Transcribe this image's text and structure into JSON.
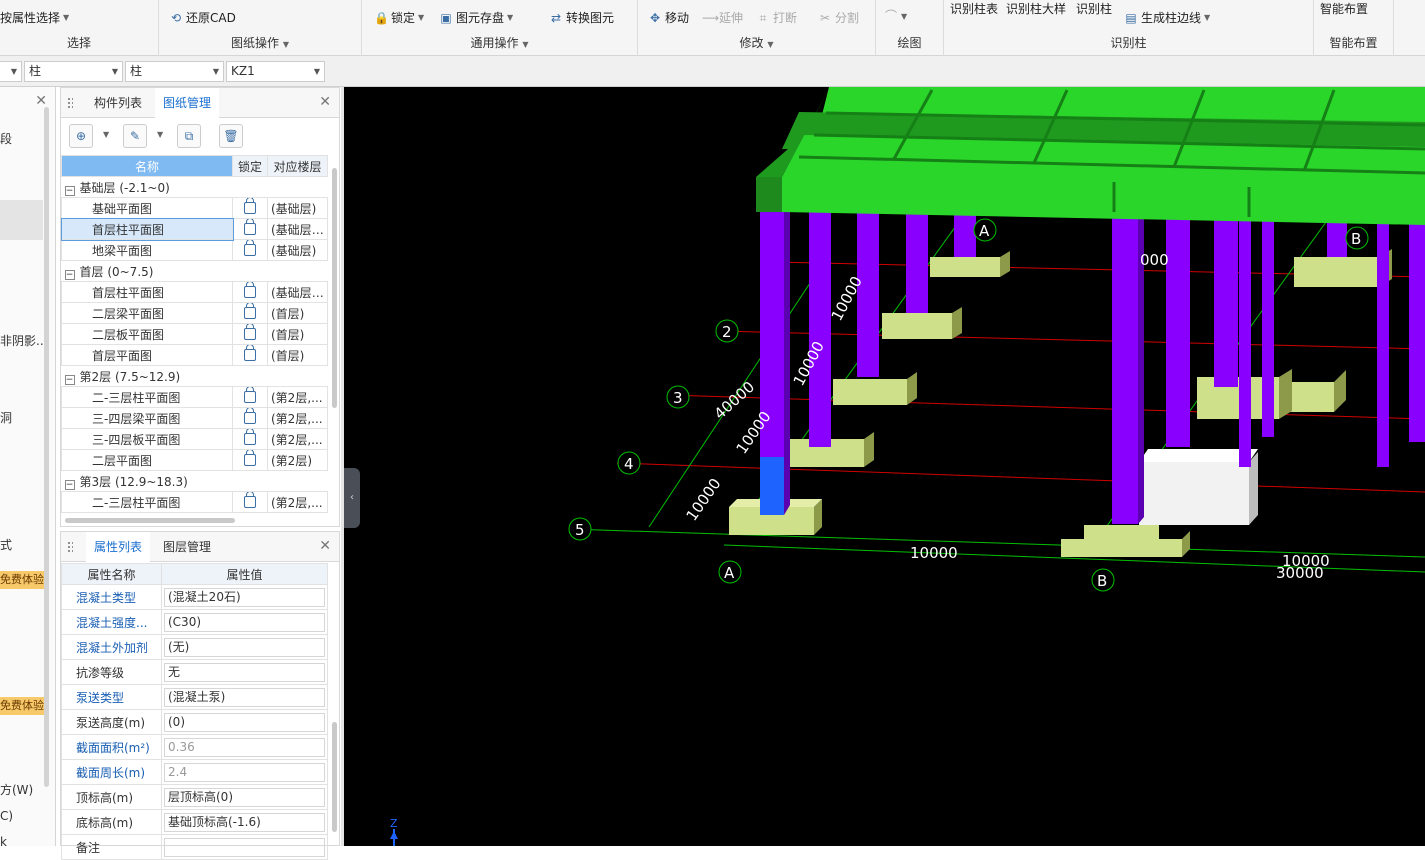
{
  "ribbon": {
    "groups": [
      {
        "label": "选择",
        "buttons": [
          {
            "label": "按属性选择"
          }
        ]
      },
      {
        "label": "图纸操作",
        "buttons": [
          {
            "label": "还原CAD"
          }
        ]
      },
      {
        "label": "通用操作",
        "buttons": [
          {
            "label": "锁定"
          },
          {
            "label": "图元存盘"
          },
          {
            "label": "转换图元"
          }
        ]
      },
      {
        "label": "修改",
        "buttons": [
          {
            "label": "移动"
          },
          {
            "label": "延伸"
          },
          {
            "label": "打断"
          },
          {
            "label": "分割"
          }
        ]
      },
      {
        "label": "绘图",
        "buttons": []
      },
      {
        "label": "识别柱",
        "buttons": [
          {
            "label": "识别柱表"
          },
          {
            "label": "识别柱大样"
          },
          {
            "label": "识别柱"
          },
          {
            "label": "生成柱边线"
          }
        ]
      },
      {
        "label": "智能布置",
        "buttons": [
          {
            "label": "智能布置"
          }
        ]
      }
    ]
  },
  "selectors": {
    "s1": "",
    "s2": "柱",
    "s3": "柱",
    "s4": "KZ1"
  },
  "left_strip": {
    "t1": "段",
    "t2": "非阴影...",
    "t3": "洞",
    "t4": "式",
    "t5": "免费体验",
    "t6": "免费体验",
    "t7": "方(W)",
    "t8": "C)",
    "t9": "k"
  },
  "drawing_panel": {
    "tabs": [
      "构件列表",
      "图纸管理"
    ],
    "active_tab": "图纸管理",
    "columns": [
      "名称",
      "锁定",
      "对应楼层"
    ],
    "rows": [
      {
        "type": "group",
        "name": "基础层 (-2.1~0)"
      },
      {
        "type": "item",
        "name": "基础平面图",
        "floor": "(基础层)"
      },
      {
        "type": "item",
        "name": "首层柱平面图",
        "floor": "(基础层,...",
        "selected": true
      },
      {
        "type": "item",
        "name": "地梁平面图",
        "floor": "(基础层)"
      },
      {
        "type": "group",
        "name": "首层 (0~7.5)"
      },
      {
        "type": "item",
        "name": "首层柱平面图",
        "floor": "(基础层,..."
      },
      {
        "type": "item",
        "name": "二层梁平面图",
        "floor": "(首层)"
      },
      {
        "type": "item",
        "name": "二层板平面图",
        "floor": "(首层)"
      },
      {
        "type": "item",
        "name": "首层平面图",
        "floor": "(首层)"
      },
      {
        "type": "group",
        "name": "第2层 (7.5~12.9)"
      },
      {
        "type": "item",
        "name": "二-三层柱平面图",
        "floor": "(第2层,..."
      },
      {
        "type": "item",
        "name": "三-四层梁平面图",
        "floor": "(第2层,..."
      },
      {
        "type": "item",
        "name": "三-四层板平面图",
        "floor": "(第2层,..."
      },
      {
        "type": "item",
        "name": "二层平面图",
        "floor": "(第2层)"
      },
      {
        "type": "group",
        "name": "第3层 (12.9~18.3)"
      },
      {
        "type": "item",
        "name": "二-三层柱平面图",
        "floor": "(第2层,..."
      }
    ]
  },
  "property_panel": {
    "tabs": [
      "属性列表",
      "图层管理"
    ],
    "active_tab": "属性列表",
    "columns": [
      "属性名称",
      "属性值"
    ],
    "rows": [
      {
        "name": "混凝土类型",
        "value": "(混凝土20石)",
        "link": true
      },
      {
        "name": "混凝土强度...",
        "value": "(C30)",
        "link": true
      },
      {
        "name": "混凝土外加剂",
        "value": "(无)",
        "link": true
      },
      {
        "name": "抗渗等级",
        "value": "无",
        "link": false
      },
      {
        "name": "泵送类型",
        "value": "(混凝土泵)",
        "link": true
      },
      {
        "name": "泵送高度(m)",
        "value": "(0)",
        "link": false
      },
      {
        "name": "截面面积(m²)",
        "value": "0.36",
        "link": true,
        "grey": true
      },
      {
        "name": "截面周长(m)",
        "value": "2.4",
        "link": true,
        "grey": true
      },
      {
        "name": "顶标高(m)",
        "value": "层顶标高(0)",
        "link": false
      },
      {
        "name": "底标高(m)",
        "value": "基础顶标高(-1.6)",
        "link": false
      },
      {
        "name": "备注",
        "value": "",
        "link": false
      }
    ]
  },
  "viewport": {
    "axis_numbers": [
      "2",
      "3",
      "4",
      "5"
    ],
    "axis_letters": [
      "A",
      "B",
      "A",
      "B"
    ],
    "dims": [
      "10000",
      "10000",
      "40000",
      "10000",
      "10000",
      "000",
      "10000",
      "10000",
      "30000"
    ],
    "z_label": "Z",
    "colors": {
      "beam": "#2bd62b",
      "column": "#8a00ff",
      "footing": "#cfe08a",
      "selected": "#1f63ff",
      "grid_red": "#d00000",
      "grid_green": "#00c000"
    }
  }
}
